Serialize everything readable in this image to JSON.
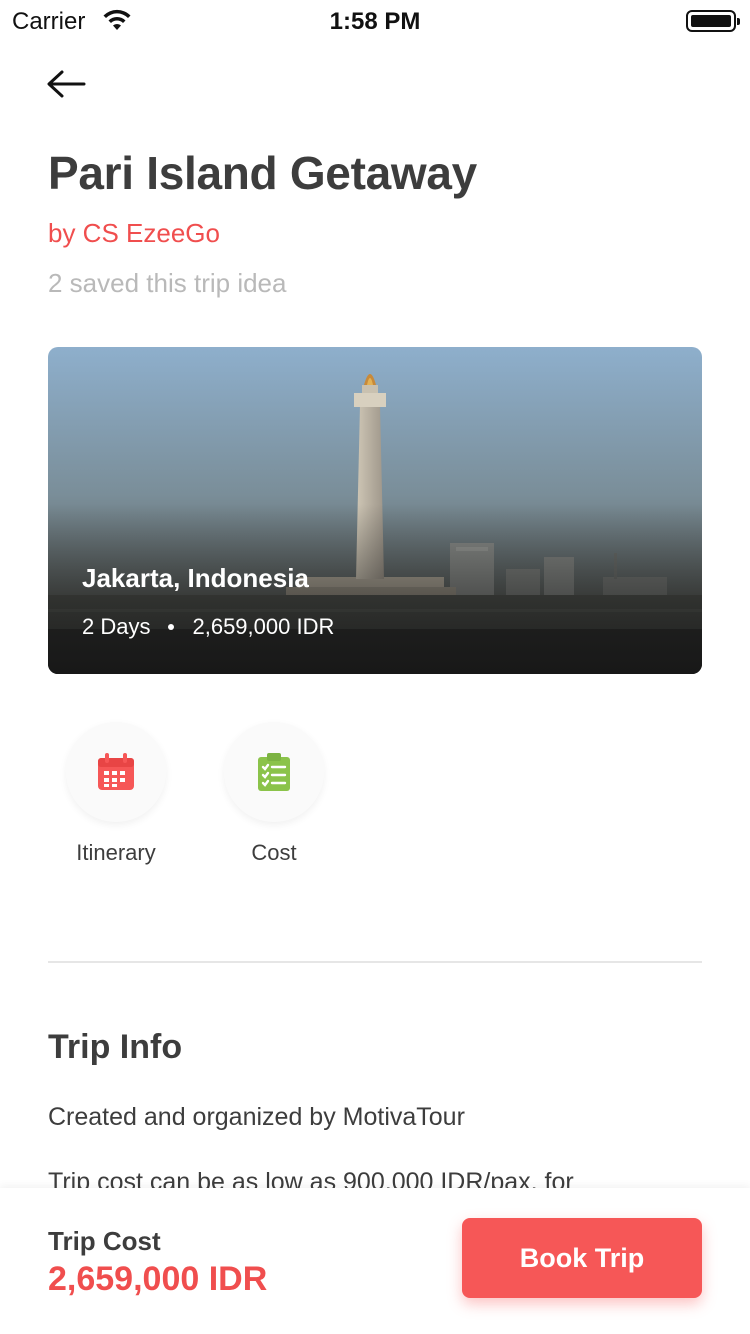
{
  "status_bar": {
    "carrier": "Carrier",
    "time": "1:58 PM"
  },
  "trip": {
    "title": "Pari Island Getaway",
    "author": "by CS EzeeGo",
    "saved": "2 saved this trip idea"
  },
  "hero": {
    "location": "Jakarta, Indonesia",
    "duration": "2 Days",
    "price": "2,659,000 IDR"
  },
  "actions": [
    {
      "label": "Itinerary",
      "icon": "calendar-icon",
      "color": "#f65757"
    },
    {
      "label": "Cost",
      "icon": "clipboard-icon",
      "color": "#8bc34a"
    }
  ],
  "trip_info": {
    "title": "Trip Info",
    "lines": [
      "Created and organized by MotivaTour",
      "Trip cost can be as low as 900,000 IDR/pax, for"
    ]
  },
  "footer": {
    "cost_label": "Trip Cost",
    "cost_value": "2,659,000 IDR",
    "book_label": "Book Trip"
  },
  "colors": {
    "accent": "#f04e4e",
    "button": "#f65757",
    "muted": "#b9b9b9"
  }
}
